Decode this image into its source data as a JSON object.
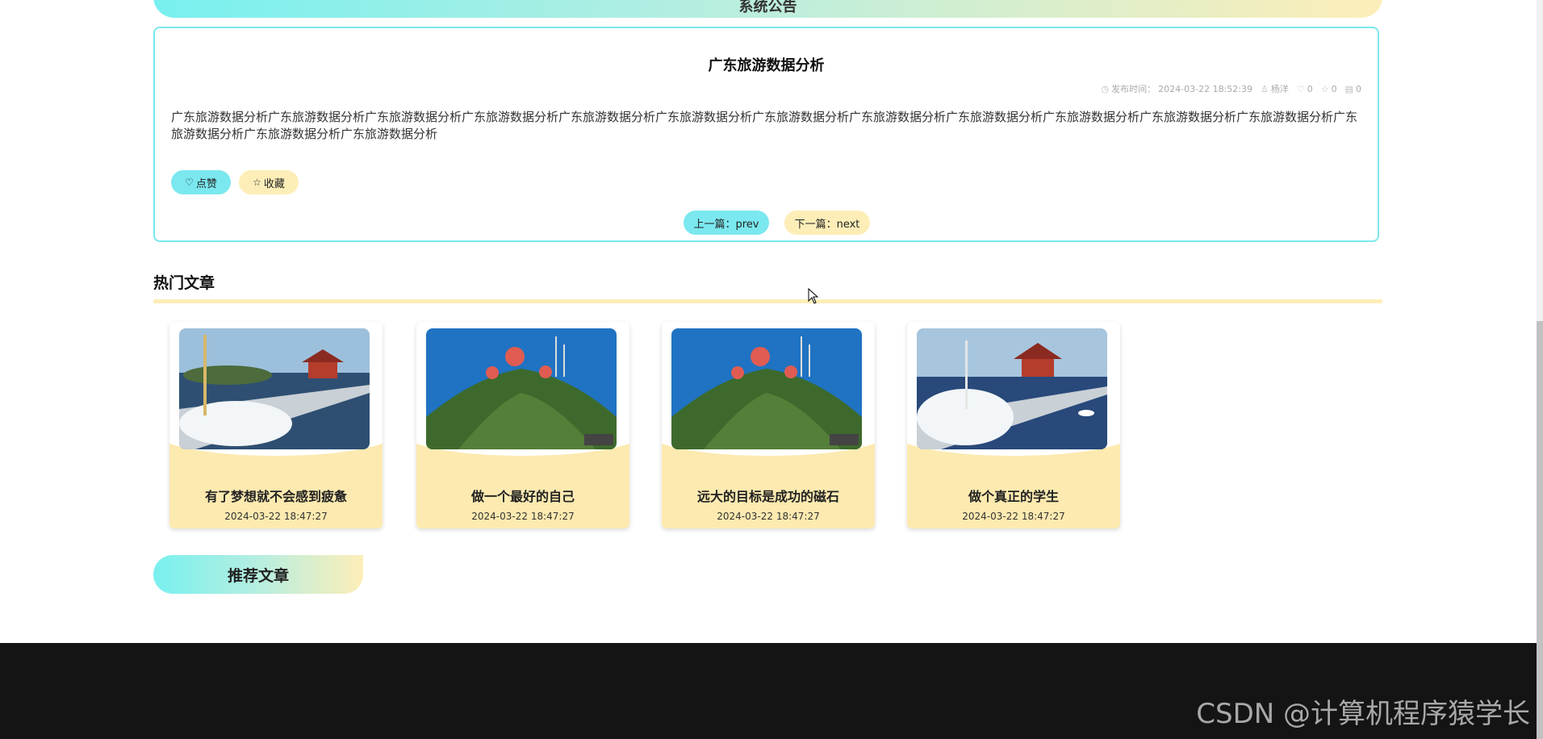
{
  "banner": {
    "title": "系统公告"
  },
  "notice": {
    "title": "广东旅游数据分析",
    "meta": {
      "publish_label": "发布时间：",
      "publish_time": "2024-03-22 18:52:39",
      "author": "杨洋",
      "likes": "0",
      "favorites": "0",
      "views": "0"
    },
    "body": "广东旅游数据分析广东旅游数据分析广东旅游数据分析广东旅游数据分析广东旅游数据分析广东旅游数据分析广东旅游数据分析广东旅游数据分析广东旅游数据分析广东旅游数据分析广东旅游数据分析广东旅游数据分析广东旅游数据分析广东旅游数据分析广东旅游数据分析",
    "like_label": "点赞",
    "favorite_label": "收藏",
    "prev_label": "上一篇：prev",
    "next_label": "下一篇：next"
  },
  "hot": {
    "title": "热门文章",
    "articles": [
      {
        "title": "有了梦想就不会感到疲惫",
        "date": "2024-03-22 18:47:27",
        "image": "pier-pavilion-waves"
      },
      {
        "title": "做一个最好的自己",
        "date": "2024-03-22 18:47:27",
        "image": "green-hill-red-domes"
      },
      {
        "title": "远大的目标是成功的磁石",
        "date": "2024-03-22 18:47:27",
        "image": "green-hill-red-domes"
      },
      {
        "title": "做个真正的学生",
        "date": "2024-03-22 18:47:27",
        "image": "pier-pavilion-waves"
      }
    ]
  },
  "recommend": {
    "title": "推荐文章"
  },
  "footer": {
    "watermark": "CSDN @计算机程序猿学长"
  },
  "colors": {
    "cyan": "#7ae8ee",
    "cream": "#fdeeb8",
    "footer": "#141414"
  }
}
